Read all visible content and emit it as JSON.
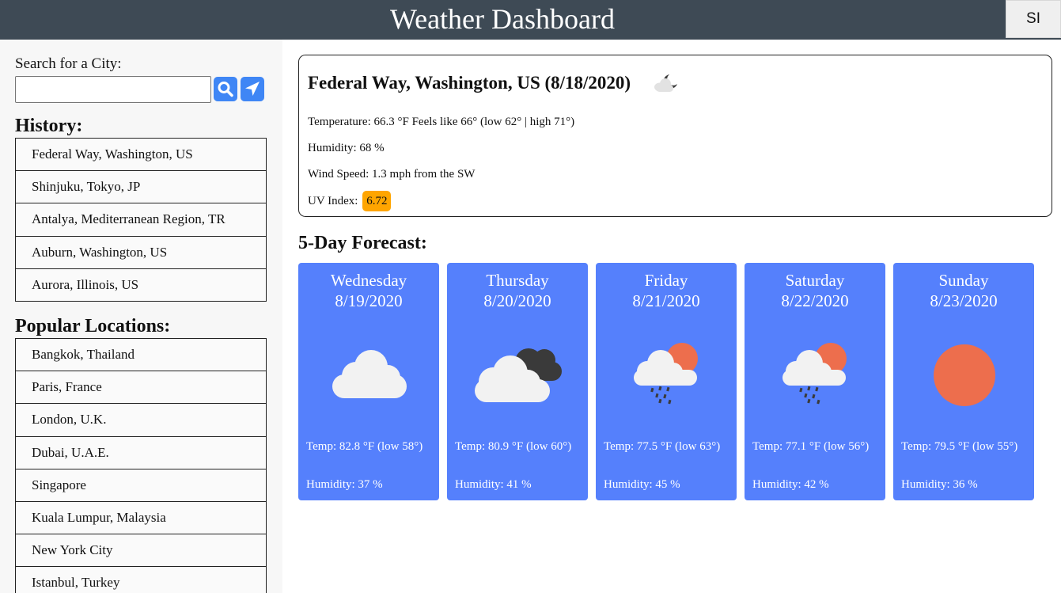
{
  "header": {
    "title": "Weather Dashboard",
    "unit_toggle": "SI"
  },
  "sidebar": {
    "search_label": "Search for a City:",
    "search_value": "",
    "search_placeholder": "",
    "history_heading": "History:",
    "history": [
      "Federal Way, Washington, US",
      "Shinjuku, Tokyo, JP",
      "Antalya, Mediterranean Region, TR",
      "Auburn, Washington, US",
      "Aurora, Illinois, US"
    ],
    "popular_heading": "Popular Locations:",
    "popular": [
      "Bangkok, Thailand",
      "Paris, France",
      "London, U.K.",
      "Dubai, U.A.E.",
      "Singapore",
      "Kuala Lumpur, Malaysia",
      "New York City",
      "Istanbul, Turkey"
    ]
  },
  "current": {
    "title": "Federal Way, Washington, US (8/18/2020)",
    "icon": "partly-cloudy-night-icon",
    "temperature": "Temperature: 66.3 °F Feels like 66° (low 62° | high 71°)",
    "humidity": "Humidity: 68 %",
    "wind": "Wind Speed: 1.3 mph from the SW",
    "uv_label": "UV Index:",
    "uv_value": "6.72",
    "uv_color": "#ffa500"
  },
  "forecast": {
    "heading": "5-Day Forecast:",
    "card_color": "#5580fc",
    "days": [
      {
        "day": "Wednesday",
        "date": "8/19/2020",
        "icon": "cloud-icon",
        "temp": "Temp: 82.8 °F (low 58°)",
        "humidity": "Humidity: 37 %"
      },
      {
        "day": "Thursday",
        "date": "8/20/2020",
        "icon": "overcast-clouds-icon",
        "temp": "Temp: 80.9 °F (low 60°)",
        "humidity": "Humidity: 41 %"
      },
      {
        "day": "Friday",
        "date": "8/21/2020",
        "icon": "sun-rain-icon",
        "temp": "Temp: 77.5 °F (low 63°)",
        "humidity": "Humidity: 45 %"
      },
      {
        "day": "Saturday",
        "date": "8/22/2020",
        "icon": "sun-rain-icon",
        "temp": "Temp: 77.1 °F (low 56°)",
        "humidity": "Humidity: 42 %"
      },
      {
        "day": "Sunday",
        "date": "8/23/2020",
        "icon": "sun-icon",
        "temp": "Temp: 79.5 °F (low 55°)",
        "humidity": "Humidity: 36 %"
      }
    ]
  }
}
